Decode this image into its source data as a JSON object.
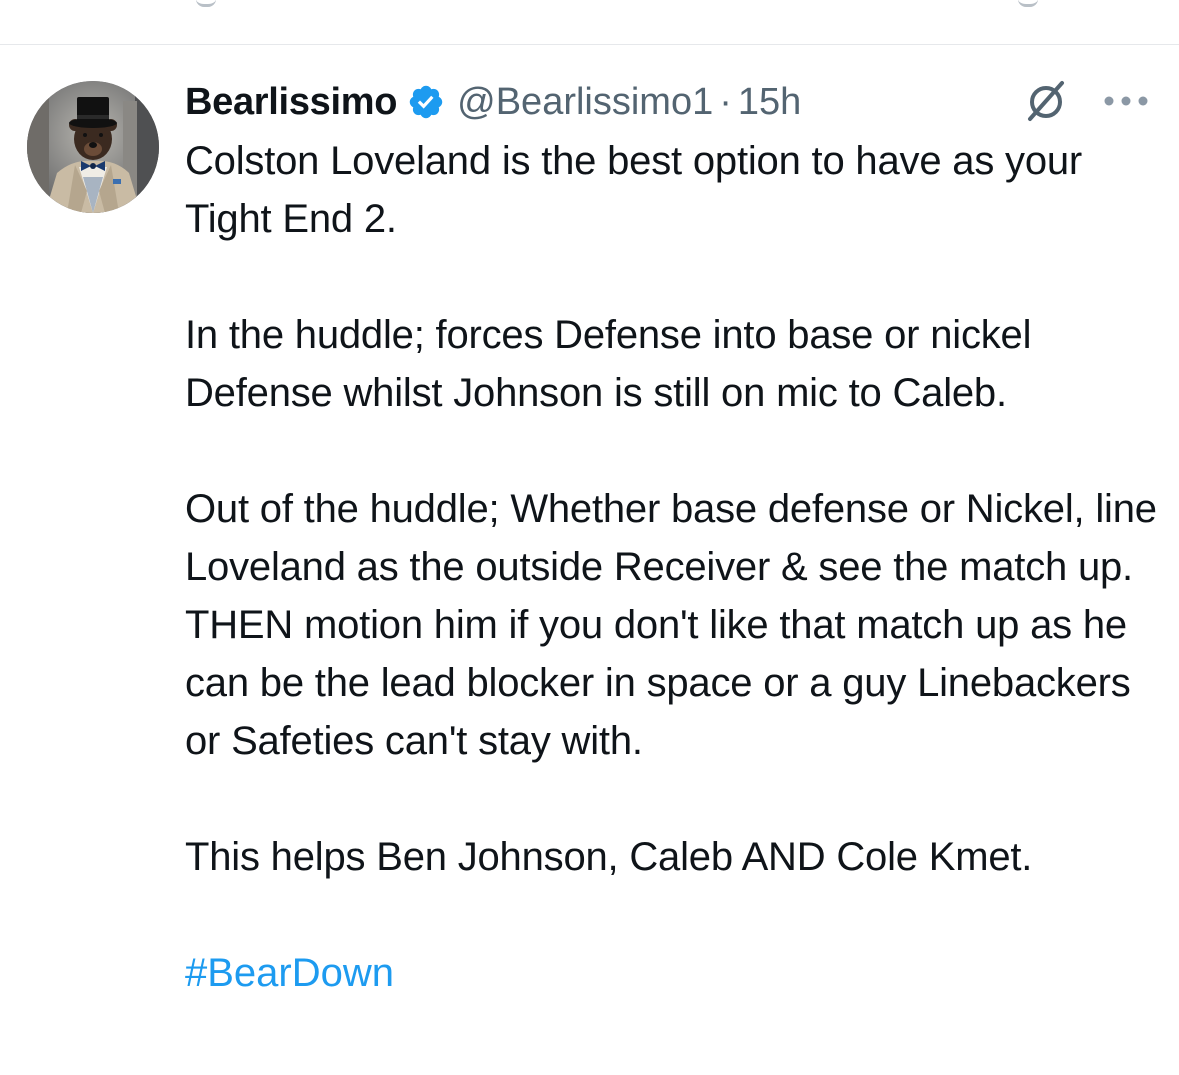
{
  "tweet": {
    "author": {
      "display_name": "Bearlissimo",
      "handle": "@Bearlissimo1",
      "separator": "·",
      "time": "15h",
      "verified": true,
      "avatar_description": "bear wearing top hat and bow tie"
    },
    "paragraphs": [
      "Colston Loveland is the best option to have as your Tight End 2.",
      "In the huddle; forces Defense into base or nickel Defense whilst Johnson is still on mic to Caleb.",
      "Out of the huddle; Whether base defense or Nickel, line Loveland as the outside Receiver & see the match up. THEN motion him if you don't like that match up as he can be the lead blocker in space or a guy Linebackers or Safeties can't stay with.",
      "This helps Ben Johnson, Caleb AND Cole Kmet."
    ],
    "hashtag": "#BearDown",
    "icons": {
      "verified": "verified-badge-icon",
      "grok": "grok-icon",
      "more": "more-options-icon"
    }
  },
  "colors": {
    "text_primary": "#0f1419",
    "text_secondary": "#536471",
    "link": "#1d9bf0",
    "verified": "#1d9bf0",
    "divider": "#e6e8eb"
  }
}
